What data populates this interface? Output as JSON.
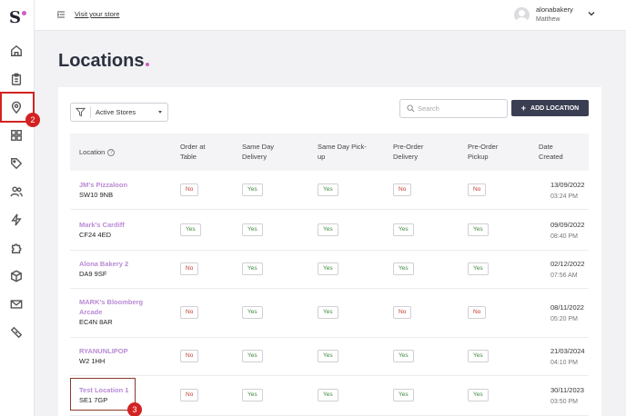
{
  "brand": {
    "logo_letter": "S",
    "accent": "#d05ec8"
  },
  "topbar": {
    "visit_store": "Visit your store",
    "user": {
      "name": "alonabakery",
      "subtitle": "Matthew"
    }
  },
  "page": {
    "title": "Locations"
  },
  "filter": {
    "label": "Active Stores"
  },
  "search": {
    "placeholder": "Search",
    "value": ""
  },
  "add_button": {
    "label": "ADD LOCATION"
  },
  "table": {
    "headers": {
      "location": "Location",
      "order_at_table": [
        "Order at",
        "Table"
      ],
      "same_day_delivery": [
        "Same Day",
        "Delivery"
      ],
      "same_day_pickup": [
        "Same Day Pick-",
        "up"
      ],
      "pre_order_delivery": [
        "Pre-Order",
        "Delivery"
      ],
      "pre_order_pickup": [
        "Pre-Order",
        "Pickup"
      ],
      "date_created": [
        "Date",
        "Created"
      ]
    },
    "rows": [
      {
        "name": [
          "JM's Pizzaloon"
        ],
        "code": "SW10 9NB",
        "flags": [
          "No",
          "Yes",
          "Yes",
          "No",
          "No"
        ],
        "date": "13/09/2022",
        "time": "03:24 PM"
      },
      {
        "name": [
          "Mark's Cardiff"
        ],
        "code": "CF24 4ED",
        "flags": [
          "Yes",
          "Yes",
          "Yes",
          "Yes",
          "Yes"
        ],
        "date": "09/09/2022",
        "time": "08:40 PM"
      },
      {
        "name": [
          "Alona Bakery 2"
        ],
        "code": "DA9 9SF",
        "flags": [
          "No",
          "Yes",
          "Yes",
          "Yes",
          "Yes"
        ],
        "date": "02/12/2022",
        "time": "07:56 AM"
      },
      {
        "name": [
          "MARK's Bloomberg",
          "Arcade"
        ],
        "code": "EC4N 8AR",
        "flags": [
          "No",
          "Yes",
          "Yes",
          "No",
          "No"
        ],
        "date": "08/11/2022",
        "time": "05:20 PM"
      },
      {
        "name": [
          "RYANUNLIPOP"
        ],
        "code": "W2 1HH",
        "flags": [
          "No",
          "Yes",
          "Yes",
          "Yes",
          "Yes"
        ],
        "date": "21/03/2024",
        "time": "04:10 PM"
      },
      {
        "name": [
          "Test Location 1"
        ],
        "code": "SE1 7GP",
        "flags": [
          "No",
          "Yes",
          "Yes",
          "Yes",
          "Yes"
        ],
        "date": "30/11/2023",
        "time": "03:50 PM"
      }
    ]
  },
  "annotations": {
    "step_sidebar": "2",
    "step_row": "3",
    "highlight_color": "#d32222"
  },
  "sidebar_icons": [
    "home-icon",
    "clipboard-icon",
    "location-pin-icon",
    "grid-icon",
    "tag-icon",
    "users-icon",
    "lightning-icon",
    "puzzle-icon",
    "box-icon",
    "mail-icon",
    "ticket-icon"
  ]
}
